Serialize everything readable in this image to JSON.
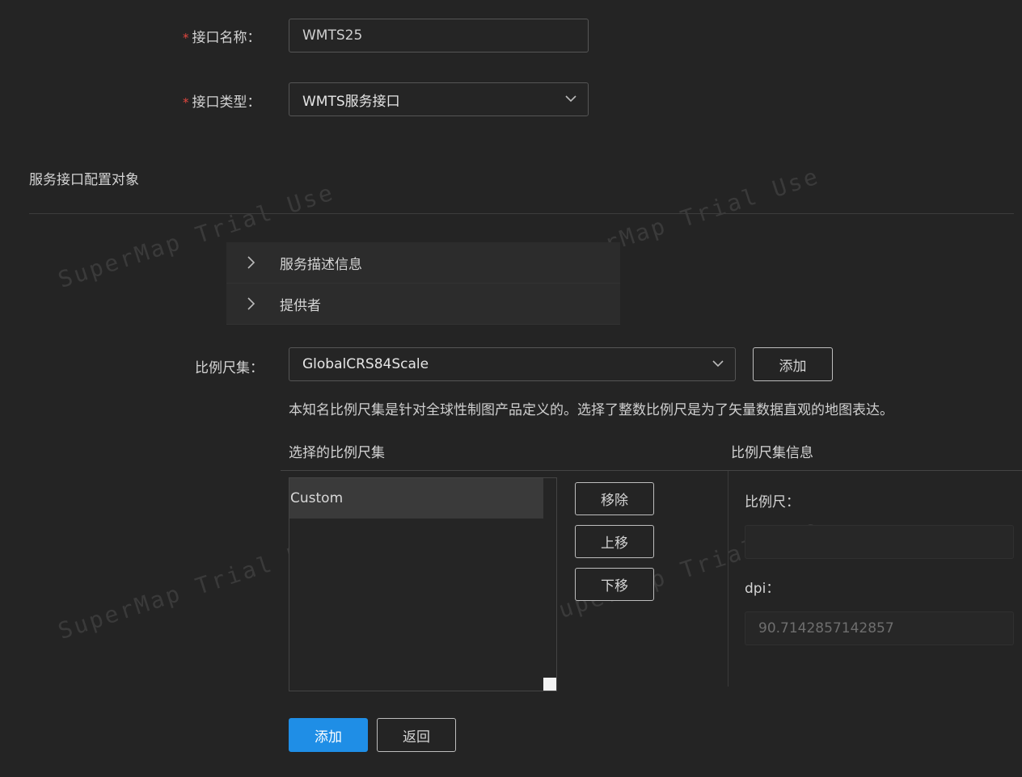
{
  "form": {
    "name_label": "接口名称",
    "name_value": "WMTS25",
    "type_label": "接口类型",
    "type_value": "WMTS服务接口",
    "colon": "："
  },
  "section": {
    "title": "服务接口配置对象"
  },
  "collapse": [
    {
      "label": "服务描述信息"
    },
    {
      "label": "提供者"
    }
  ],
  "scaleset": {
    "label": "比例尺集",
    "value": "GlobalCRS84Scale",
    "add_button": "添加",
    "description": "本知名比例尺集是针对全球性制图产品定义的。选择了整数比例尺是为了矢量数据直观的地图表达。"
  },
  "selected": {
    "header": "选择的比例尺集",
    "items": [
      "Custom"
    ],
    "remove_button": "移除",
    "up_button": "上移",
    "down_button": "下移"
  },
  "info": {
    "header": "比例尺集信息",
    "scale_label": "比例尺",
    "scale_value": "",
    "dpi_label": "dpi",
    "dpi_value": "90.7142857142857"
  },
  "footer": {
    "add_button": "添加",
    "back_button": "返回"
  },
  "watermark_text": "SuperMap Trial Use",
  "colors": {
    "primary": "#1f8ee6",
    "required": "#e2473f",
    "background": "#242424"
  }
}
